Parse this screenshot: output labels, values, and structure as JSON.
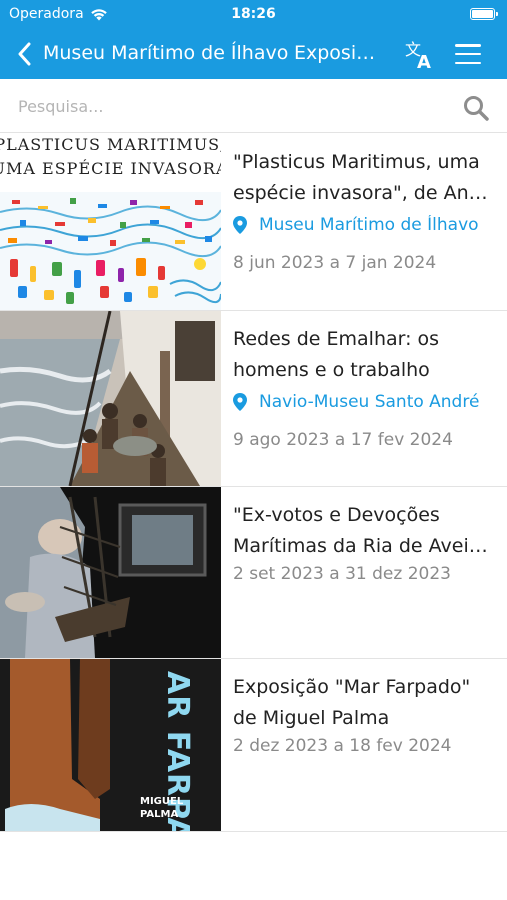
{
  "status_bar": {
    "carrier": "Operadora",
    "time": "18:26"
  },
  "nav": {
    "title": "Museu Marítimo de Ílhavo",
    "subtitle": "Exposições"
  },
  "search": {
    "placeholder": "Pesquisa..."
  },
  "colors": {
    "accent": "#1a9be0",
    "muted": "#8a8a8a",
    "text": "#222222"
  },
  "exhibitions": [
    {
      "title_line1": "\"Plasticus Maritimus, uma",
      "title_line2": "espécie invasora\", de Ana Pêgo",
      "location": "Museu Marítimo de Ílhavo",
      "dates": "8 jun 2023 a 7 jan 2024",
      "poster_line1": "PLASTICUS MARITIMUS,",
      "poster_line2": "UMA ESPÉCIE INVASORA"
    },
    {
      "title_line1": "Redes de Emalhar: os",
      "title_line2": "homens e o trabalho",
      "location": "Navio-Museu Santo André",
      "dates": "9 ago 2023 a 17 fev 2024"
    },
    {
      "title_line1": "\"Ex-votos e Devoções",
      "title_line2": "Marítimas da Ria de Aveiro\"",
      "dates": "2 set 2023 a 31 dez 2023"
    },
    {
      "title_line1": "Exposição \"Mar Farpado\"",
      "title_line2": "de Miguel Palma",
      "dates": "2 dez 2023 a 18 fev 2024",
      "poster_title": "AR FARPADO",
      "poster_author_line1": "MIGUEL",
      "poster_author_line2": "PALMA"
    }
  ]
}
